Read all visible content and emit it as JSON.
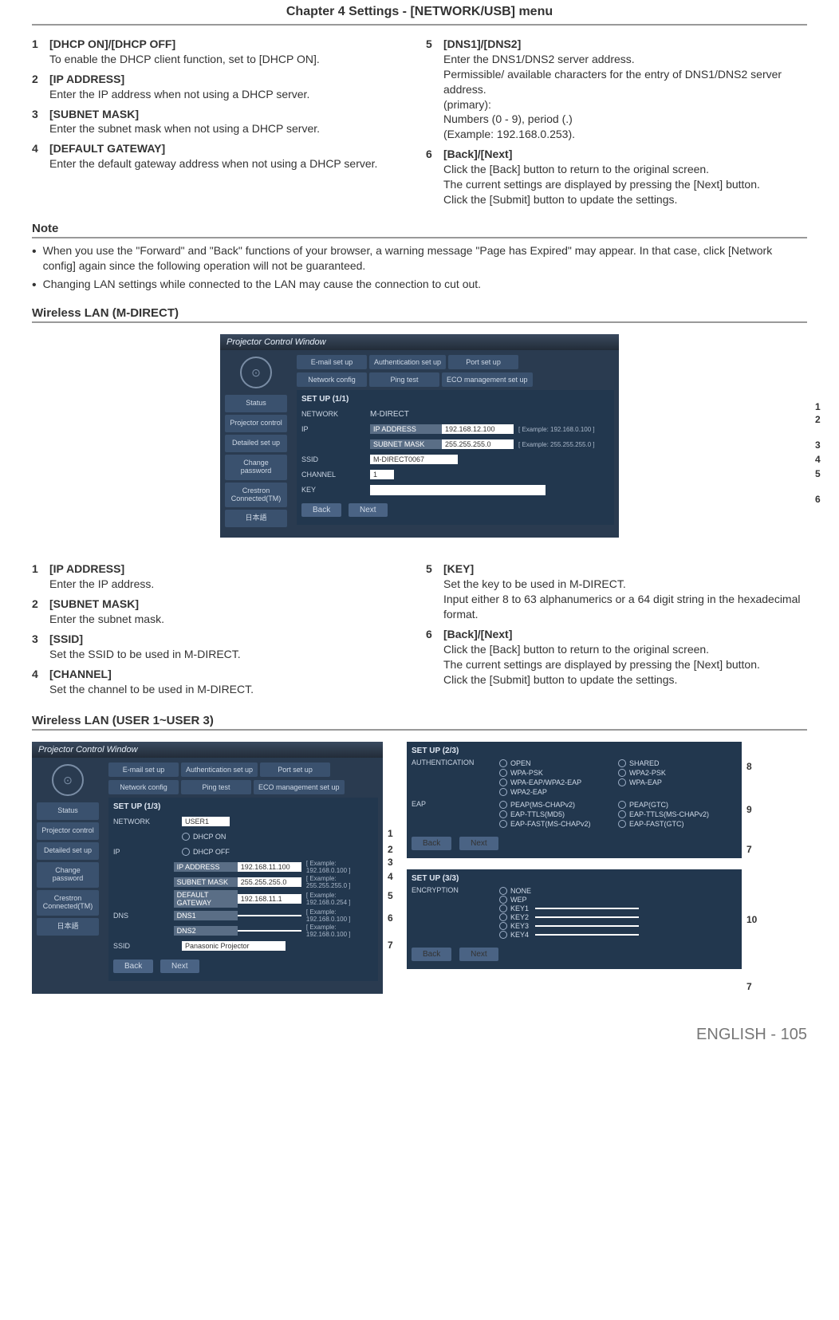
{
  "chapter_title": "Chapter 4   Settings - [NETWORK/USB] menu",
  "leftA": [
    {
      "n": "1",
      "t": "[DHCP ON]/[DHCP OFF]",
      "d": "To enable the DHCP client function, set to [DHCP ON]."
    },
    {
      "n": "2",
      "t": "[IP ADDRESS]",
      "d": "Enter the IP address when not using a DHCP server."
    },
    {
      "n": "3",
      "t": "[SUBNET MASK]",
      "d": "Enter the subnet mask when not using a DHCP server."
    },
    {
      "n": "4",
      "t": "[DEFAULT GATEWAY]",
      "d": "Enter the default gateway address when not using a DHCP server."
    }
  ],
  "rightA": [
    {
      "n": "5",
      "t": "[DNS1]/[DNS2]",
      "d": "Enter the DNS1/DNS2 server address.\nPermissible/ available characters for the entry of DNS1/DNS2 server address.\n(primary):\nNumbers (0 - 9), period (.)\n(Example: 192.168.0.253)."
    },
    {
      "n": "6",
      "t": "[Back]/[Next]",
      "d": "Click the [Back] button to return to the original screen.\nThe current settings are displayed by pressing the [Next] button.\nClick the [Submit] button to update the settings."
    }
  ],
  "note_head": "Note",
  "notes": [
    "When you use the \"Forward\" and \"Back\" functions of your browser, a warning message \"Page has Expired\" may appear. In that case, click [Network config] again since the following operation will not be guaranteed.",
    "Changing LAN settings while connected to the LAN may cause the connection to cut out."
  ],
  "sec_mdirect": "Wireless LAN (M-DIRECT)",
  "win": {
    "title": "Projector Control Window",
    "tabs": {
      "email": "E-mail set up",
      "auth": "Authentication set up",
      "port": "Port set up",
      "net": "Network config",
      "ping": "Ping test",
      "eco": "ECO management set up"
    },
    "side": {
      "status": "Status",
      "proj": "Projector control",
      "det": "Detailed set up",
      "chg": "Change password",
      "cres": "Crestron Connected(TM)",
      "jp": "日本語"
    },
    "panel1_title": "SET UP (1/1)",
    "labels": {
      "network": "NETWORK",
      "ip": "IP",
      "ssid": "SSID",
      "channel": "CHANNEL",
      "key": "KEY",
      "ipaddr": "IP ADDRESS",
      "subnet": "SUBNET MASK",
      "gateway": "DEFAULT GATEWAY",
      "dns": "DNS",
      "dns1": "DNS1",
      "dns2": "DNS2",
      "back": "Back",
      "next": "Next"
    },
    "vals": {
      "network": "M-DIRECT",
      "ip": "192.168.12.100",
      "iphint": "[ Example: 192.168.0.100 ]",
      "sub": "255.255.255.0",
      "subhint": "[ Example: 255.255.255.0 ]",
      "ssid": "M-DIRECT0067",
      "ch": "1"
    }
  },
  "mdirect_callouts": [
    "1",
    "2",
    "3",
    "4",
    "5",
    "6"
  ],
  "leftB": [
    {
      "n": "1",
      "t": "[IP ADDRESS]",
      "d": "Enter the IP address."
    },
    {
      "n": "2",
      "t": "[SUBNET MASK]",
      "d": "Enter the subnet mask."
    },
    {
      "n": "3",
      "t": "[SSID]",
      "d": "Set the SSID to be used in M-DIRECT."
    },
    {
      "n": "4",
      "t": "[CHANNEL]",
      "d": "Set the channel to be used in M-DIRECT."
    }
  ],
  "rightB": [
    {
      "n": "5",
      "t": "[KEY]",
      "d": "Set the key to be used in M-DIRECT.\nInput either 8 to 63 alphanumerics or a 64 digit string in the hexadecimal format."
    },
    {
      "n": "6",
      "t": "[Back]/[Next]",
      "d": "Click the [Back] button to return to the original screen.\nThe current settings are displayed by pressing the [Next] button.\nClick the [Submit] button to update the settings."
    }
  ],
  "sec_user": "Wireless LAN (USER 1~USER 3)",
  "user": {
    "panelL_title": "SET UP (1/3)",
    "network_val": "USER1",
    "dhcp_on": "DHCP ON",
    "dhcp_off": "DHCP OFF",
    "ip": "192.168.11.100",
    "iphint": "[ Example: 192.168.0.100 ]",
    "sub": "255.255.255.0",
    "subhint": "[ Example: 255.255.255.0 ]",
    "gw": "192.168.11.1",
    "gwhint": "[ Example: 192.168.0.254 ]",
    "dnshint": "[ Example: 192.168.0.100 ]",
    "ssid_val": "Panasonic Projector",
    "panel2_title": "SET UP (2/3)",
    "auth_lbl": "AUTHENTICATION",
    "eap_lbl": "EAP",
    "auth_opts": [
      "OPEN",
      "SHARED",
      "WPA-PSK",
      "WPA2-PSK",
      "WPA-EAP/WPA2-EAP",
      "WPA-EAP",
      "WPA2-EAP"
    ],
    "eap_opts": [
      "PEAP(MS-CHAPv2)",
      "PEAP(GTC)",
      "EAP-TTLS(MD5)",
      "EAP-TTLS(MS-CHAPv2)",
      "EAP-FAST(MS-CHAPv2)",
      "EAP-FAST(GTC)"
    ],
    "panel3_title": "SET UP (3/3)",
    "enc_lbl": "ENCRYPTION",
    "enc_opts": [
      "NONE",
      "WEP"
    ],
    "keys": [
      "KEY1",
      "KEY2",
      "KEY3",
      "KEY4"
    ]
  },
  "user_callouts_left": [
    "1",
    "2",
    "3",
    "4",
    "5",
    "6",
    "7"
  ],
  "user_callouts_right": [
    "8",
    "9",
    "7",
    "10",
    "7"
  ],
  "footer": "ENGLISH - 105"
}
